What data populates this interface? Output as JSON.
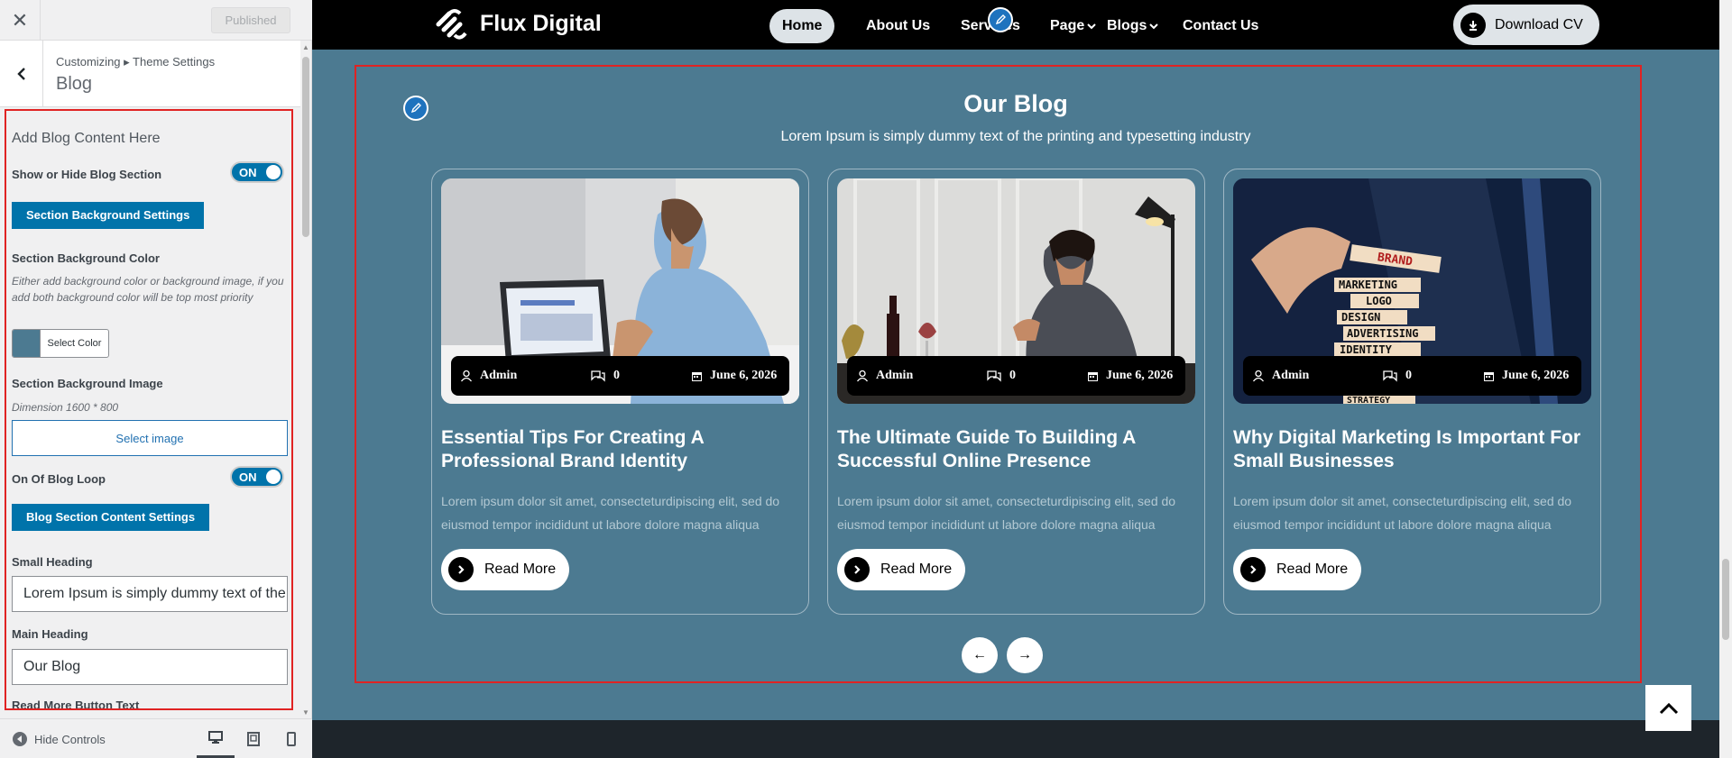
{
  "customizer": {
    "close_icon": "close-icon",
    "published_label": "Published",
    "breadcrumb": "Customizing ▸ Theme Settings",
    "title": "Blog",
    "section_title": "Add Blog Content Here",
    "show_hide_label": "Show or Hide Blog Section",
    "toggle_on": "ON",
    "bg_settings_btn": "Section Background Settings",
    "bg_color_label": "Section Background Color",
    "bg_color_desc": "Either add background color or background image, if you add both background color will be top most priority",
    "select_color": "Select Color",
    "bg_color_value": "#4c7a91",
    "bg_image_label": "Section Background Image",
    "bg_image_dim": "Dimension 1600 * 800",
    "select_image": "Select image",
    "blog_loop_label": "On Of Blog Loop",
    "content_settings_btn": "Blog Section Content Settings",
    "small_heading_label": "Small Heading",
    "small_heading_value": "Lorem Ipsum is simply dummy text of the printing and typesetting industry",
    "main_heading_label": "Main Heading",
    "main_heading_value": "Our Blog",
    "read_more_label": "Read More Button Text",
    "hide_controls": "Hide Controls"
  },
  "nav": {
    "brand": "Flux Digital",
    "items": [
      "Home",
      "About Us",
      "Services",
      "Page",
      "Blogs",
      "Contact Us"
    ],
    "download_label": "Download CV"
  },
  "blog": {
    "title": "Our Blog",
    "subtitle": "Lorem Ipsum is simply dummy text of the printing and typesetting industry",
    "cards": [
      {
        "author": "Admin",
        "comments": "0",
        "date": "June 6, 2026",
        "title": "Essential Tips For Creating A Professional Brand Identity",
        "excerpt": "Lorem ipsum dolor sit amet, consecteturdipiscing elit, sed do eiusmod tempor incididunt ut labore dolore magna aliqua",
        "button": "Read More"
      },
      {
        "author": "Admin",
        "comments": "0",
        "date": "June 6, 2026",
        "title": "The Ultimate Guide To Building A Successful Online Presence",
        "excerpt": "Lorem ipsum dolor sit amet, consecteturdipiscing elit, sed do eiusmod tempor incididunt ut labore dolore magna aliqua",
        "button": "Read More"
      },
      {
        "author": "Admin",
        "comments": "0",
        "date": "June 6, 2026",
        "title": "Why Digital Marketing Is Important For Small Businesses",
        "excerpt": "Lorem ipsum dolor sit amet, consecteturdipiscing elit, sed do eiusmod tempor incididunt ut labore dolore magna aliqua",
        "button": "Read More",
        "image_words": [
          "BRAND",
          "MARKETING",
          "LOGO",
          "DESIGN",
          "ADVERTISING",
          "IDENTITY",
          "STRATEGY"
        ]
      }
    ],
    "prev_arrow": "←",
    "next_arrow": "→"
  }
}
